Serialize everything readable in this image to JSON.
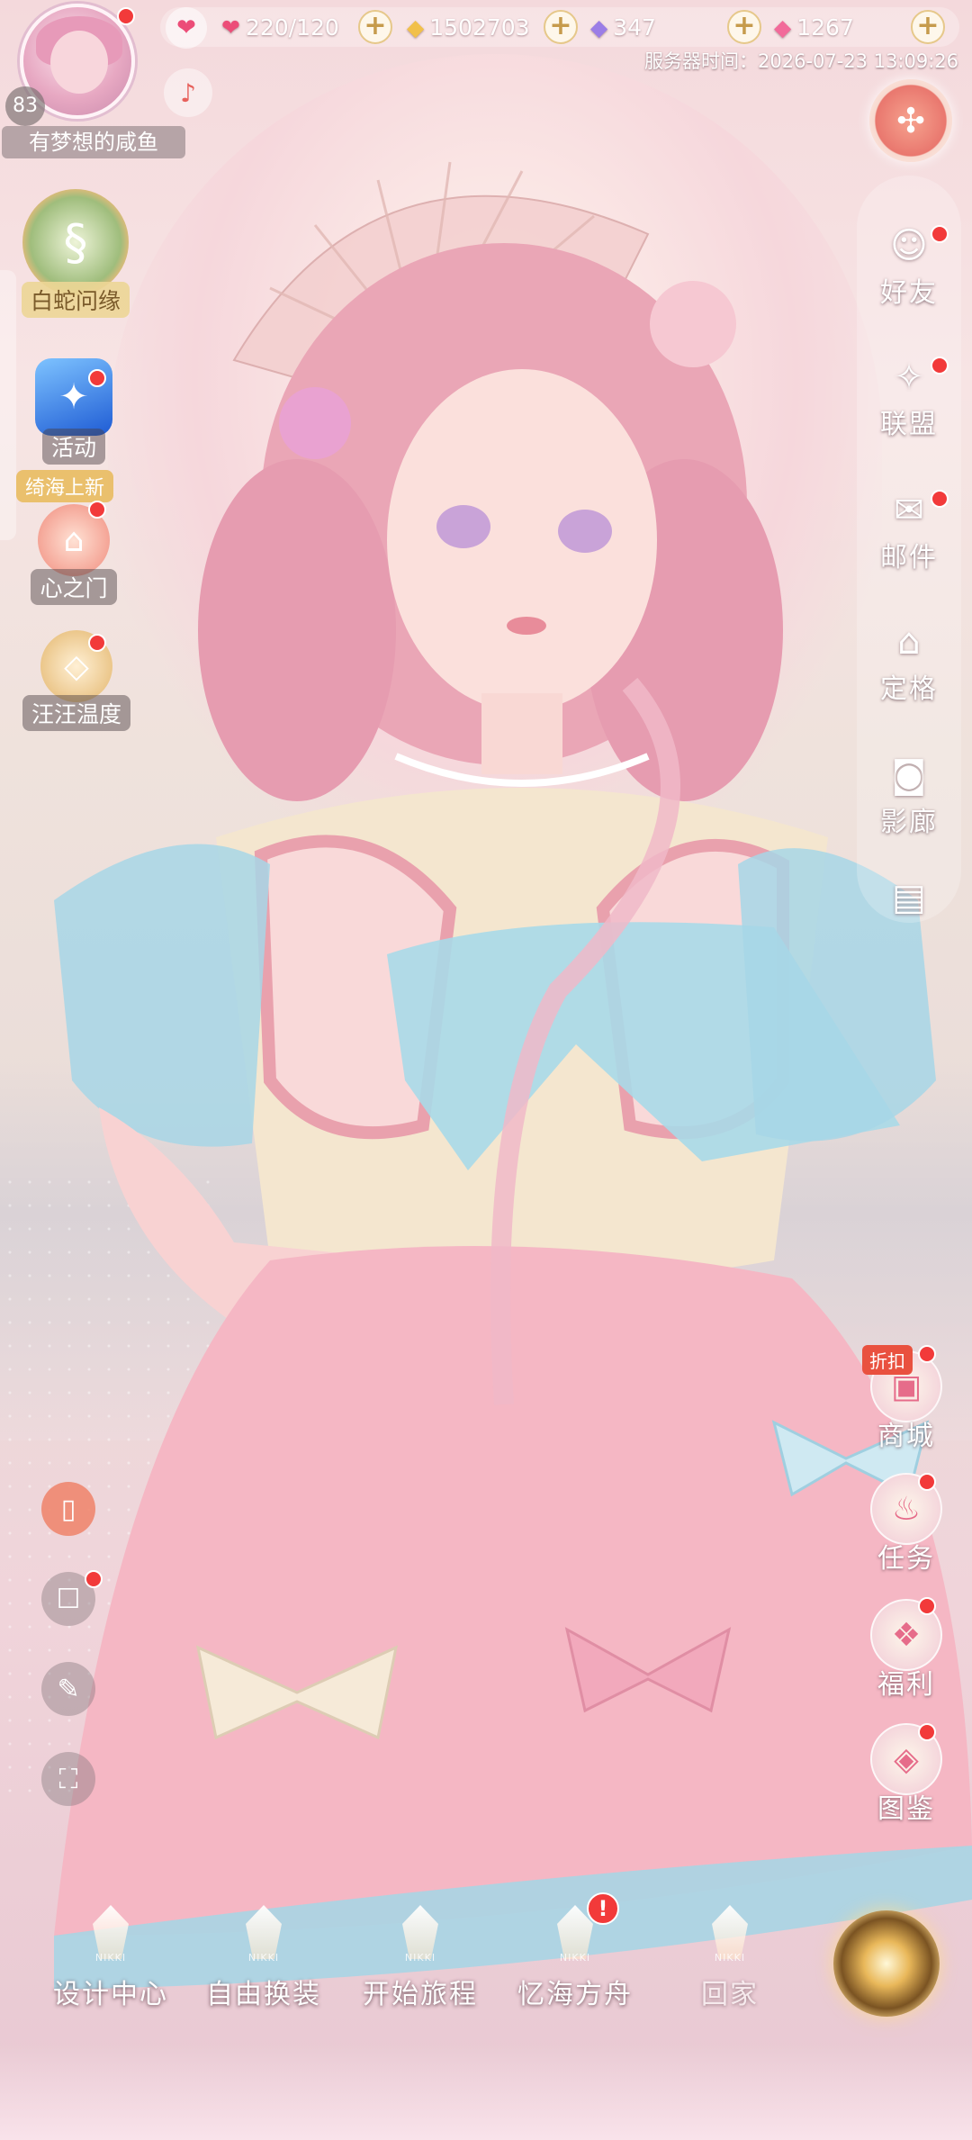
{
  "player": {
    "nickname": "有梦想的咸鱼",
    "level": "83"
  },
  "resources": {
    "stamina": "220/120",
    "gold": "1502703",
    "diamond": "347",
    "crystal": "1267"
  },
  "server_time": "服务器时间：2026-07-23 13:09:26",
  "left_menu": {
    "event_banner": "白蛇问缘",
    "activity": "活动",
    "activity_tag": "绮海上新",
    "heart_gate": "心之门",
    "wangwang": "汪汪温度"
  },
  "right_menu": [
    "好友",
    "联盟",
    "邮件",
    "定格",
    "影廊"
  ],
  "lower_right": {
    "sale_tag": "折扣",
    "shop": "商城",
    "tasks": "任务",
    "welfare": "福利",
    "atlas": "图鉴"
  },
  "bottom_nav": [
    {
      "label": "设计中心"
    },
    {
      "label": "自由换装"
    },
    {
      "label": "开始旅程"
    },
    {
      "label": "忆海方舟"
    },
    {
      "label": "回家"
    }
  ],
  "nav_crystal_caption": "NIKKI",
  "alert_mark": "!",
  "colors": {
    "red_dot": "#f23a3a",
    "gold": "#e6c88a",
    "pink": "#ec4d78"
  }
}
